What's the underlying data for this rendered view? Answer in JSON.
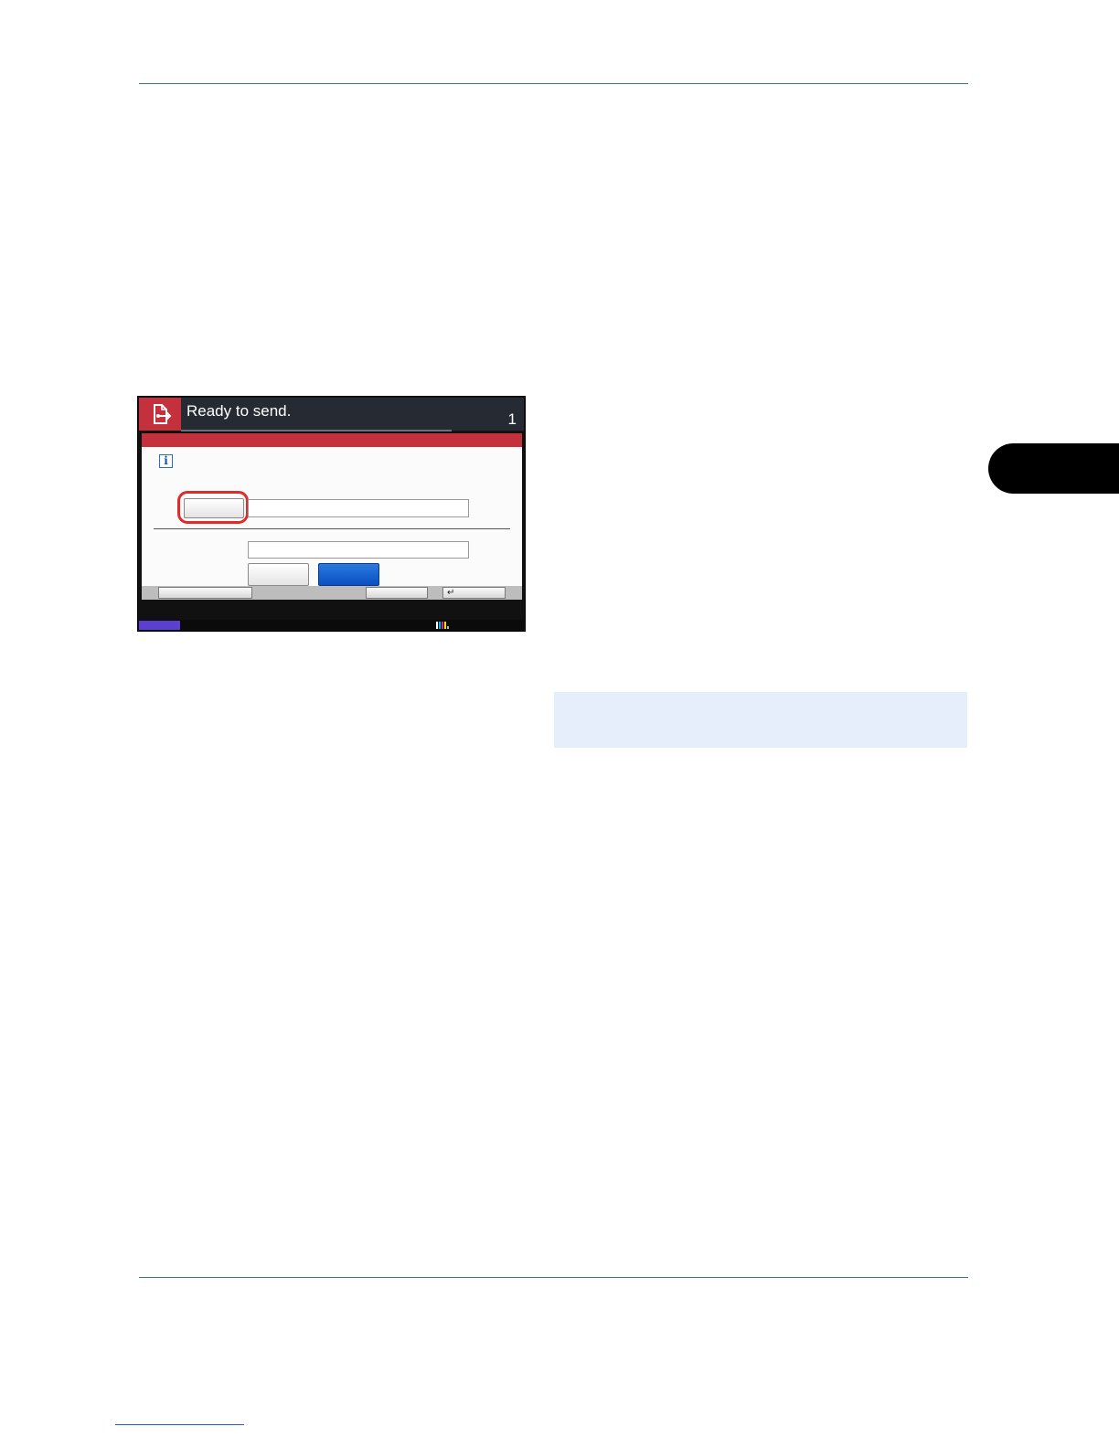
{
  "device": {
    "status_text": "Ready to send.",
    "job_count": "1",
    "icons": {
      "mode": "send-document-icon",
      "info": "info-icon",
      "enter": "enter-arrow-icon",
      "toner": "toner-level-icon"
    },
    "info_glyph": "i",
    "enter_glyph": "↵",
    "colors": {
      "title_bar": "#262a33",
      "accent_red": "#c5303d",
      "highlight_ring": "#e02b2b",
      "selected_button": "#0a4fc0",
      "status_indicator": "#5b3fd1",
      "note_background": "#e6edfb",
      "rule": "#3a6fb0"
    }
  }
}
